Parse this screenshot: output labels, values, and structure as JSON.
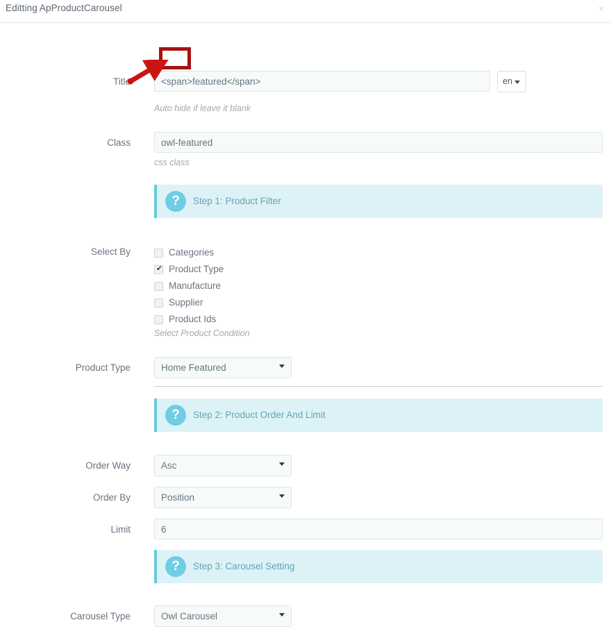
{
  "modal": {
    "title": "Editting ApProductCarousel",
    "close_label": "×"
  },
  "form": {
    "title_field": {
      "label": "Title",
      "value": "<span>featured</span>",
      "help": "Auto hide if leave it blank",
      "lang": "en"
    },
    "class_field": {
      "label": "Class",
      "value": "owl-featured",
      "help": "css class"
    },
    "step1": {
      "icon": "question-mark-icon",
      "text": "Step 1: Product Filter"
    },
    "select_by": {
      "label": "Select By",
      "help": "Select Product Condition",
      "options": [
        {
          "label": "Categories",
          "checked": false
        },
        {
          "label": "Product Type",
          "checked": true
        },
        {
          "label": "Manufacture",
          "checked": false
        },
        {
          "label": "Supplier",
          "checked": false
        },
        {
          "label": "Product Ids",
          "checked": false
        }
      ]
    },
    "product_type": {
      "label": "Product Type",
      "value": "Home Featured"
    },
    "step2": {
      "icon": "question-mark-icon",
      "text": "Step 2: Product Order And Limit"
    },
    "order_way": {
      "label": "Order Way",
      "value": "Asc"
    },
    "order_by": {
      "label": "Order By",
      "value": "Position"
    },
    "limit": {
      "label": "Limit",
      "value": "6"
    },
    "step3": {
      "icon": "question-mark-icon",
      "text": "Step 3: Carousel Setting"
    },
    "carousel_type": {
      "label": "Carousel Type",
      "value": "Owl Carousel"
    }
  },
  "annotation": {
    "color": "#a81111",
    "target": "title-input-start"
  }
}
